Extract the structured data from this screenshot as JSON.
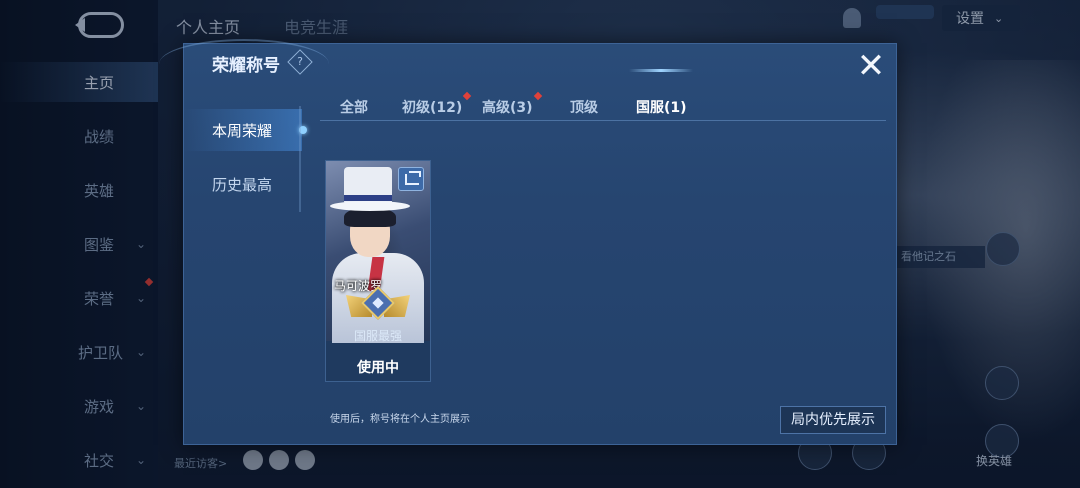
{
  "background": {
    "nav": {
      "items": [
        {
          "label": "主页",
          "has_chevron": false
        },
        {
          "label": "战绩",
          "has_chevron": false
        },
        {
          "label": "英雄",
          "has_chevron": false
        },
        {
          "label": "图鉴",
          "has_chevron": true
        },
        {
          "label": "荣誉",
          "has_chevron": true
        },
        {
          "label": "护卫队",
          "has_chevron": true
        },
        {
          "label": "游戏",
          "has_chevron": true
        },
        {
          "label": "社交",
          "has_chevron": true
        }
      ],
      "active_index": 0
    },
    "top_tabs": [
      "个人主页",
      "电竞生涯"
    ],
    "settings_label": "设置",
    "side_tag": "看他记之石",
    "change_hero_label": "换英雄",
    "recent_visitors_label": "最近访客>"
  },
  "modal": {
    "title": "荣耀称号",
    "help_symbol": "?",
    "close_symbol": "✕",
    "side_menu": [
      {
        "label": "本周荣耀",
        "active": true
      },
      {
        "label": "历史最高",
        "active": false
      }
    ],
    "tabs": [
      {
        "label": "全部",
        "active": false,
        "red_dot": false
      },
      {
        "label": "初级(12)",
        "active": false,
        "red_dot": true
      },
      {
        "label": "高级(3)",
        "active": false,
        "red_dot": true
      },
      {
        "label": "顶级",
        "active": false,
        "red_dot": false
      },
      {
        "label": "国服(1)",
        "active": true,
        "red_dot": false
      }
    ],
    "title_card": {
      "hero_name": "马可波罗",
      "title_text": "国服最强",
      "status": "使用中"
    },
    "hint_text": "使用后，称号将在个人主页展示",
    "priority_button": "局内优先展示"
  },
  "colors": {
    "accent": "#8fd0ff",
    "red_dot": "#e0413a",
    "gold": "#e8c86a"
  }
}
